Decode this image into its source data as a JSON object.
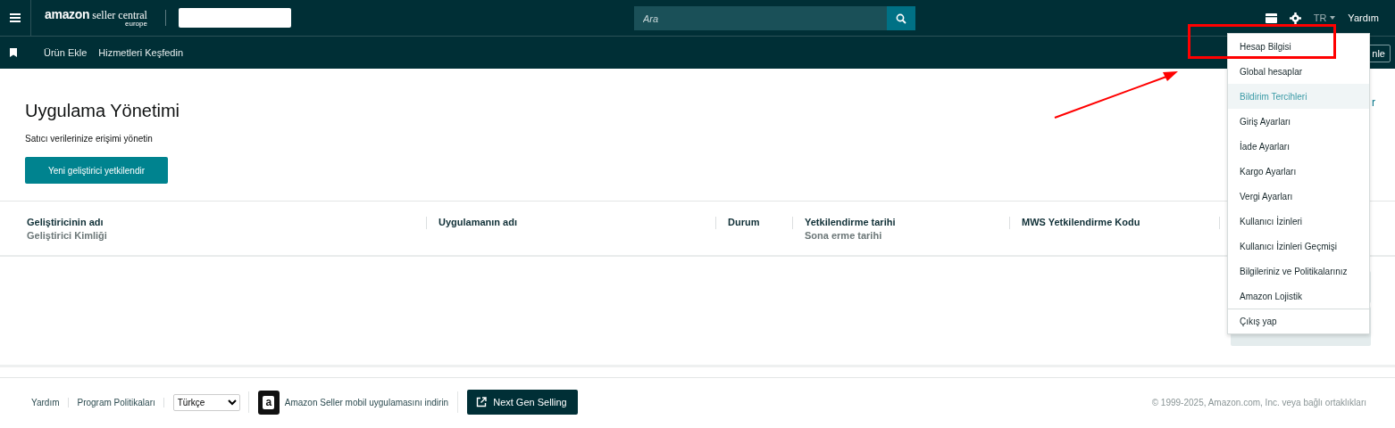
{
  "top_bar": {
    "logo": {
      "brand": "amazon",
      "product": "seller central",
      "region": "europe"
    },
    "search": {
      "placeholder": "Ara"
    },
    "language": "TR",
    "help": "Yardım"
  },
  "nav_bar": {
    "links": [
      "Ürün Ekle",
      "Hizmetleri Keşfedin"
    ],
    "right_button": "nle"
  },
  "page": {
    "title": "Uygulama Yönetimi",
    "subtitle": "Satıcı verilerinize erişimi yönetin",
    "primary_button": "Yeni geliştirici yetkilendir",
    "right_link": "r"
  },
  "table": {
    "columns": [
      {
        "title": "Geliştiricinin adı",
        "subtitle": "Geliştirici Kimliği"
      },
      {
        "title": "Uygulamanın adı"
      },
      {
        "title": "Durum"
      },
      {
        "title": "Yetkilendirme tarihi",
        "subtitle": "Sona erme tarihi"
      },
      {
        "title": "MWS Yetkilendirme Kodu"
      }
    ]
  },
  "settings_menu": {
    "items": [
      {
        "label": "Hesap Bilgisi",
        "selected": false
      },
      {
        "label": "Global hesaplar",
        "selected": false
      },
      {
        "label": "Bildirim Tercihleri",
        "selected": true
      },
      {
        "label": "Giriş Ayarları",
        "selected": false
      },
      {
        "label": "İade Ayarları",
        "selected": false
      },
      {
        "label": "Kargo Ayarları",
        "selected": false
      },
      {
        "label": "Vergi Ayarları",
        "selected": false
      },
      {
        "label": "Kullanıcı İzinleri",
        "selected": false
      },
      {
        "label": "Kullanıcı İzinleri Geçmişi",
        "selected": false
      },
      {
        "label": "Bilgileriniz ve Politikalarınız",
        "selected": false
      },
      {
        "label": "Amazon Lojistik",
        "selected": false
      },
      {
        "label": "Çıkış yap",
        "selected": false,
        "divider_before": true
      }
    ]
  },
  "footer": {
    "links": [
      "Yardım",
      "Program Politikaları"
    ],
    "language_select": "Türkçe",
    "app_text": "Amazon Seller mobil uygulamasını indirin",
    "app_icon_letter": "a",
    "next_gen_button": "Next Gen Selling",
    "copyright": "© 1999-2025, Amazon.com, Inc. veya bağlı ortaklıkları"
  }
}
